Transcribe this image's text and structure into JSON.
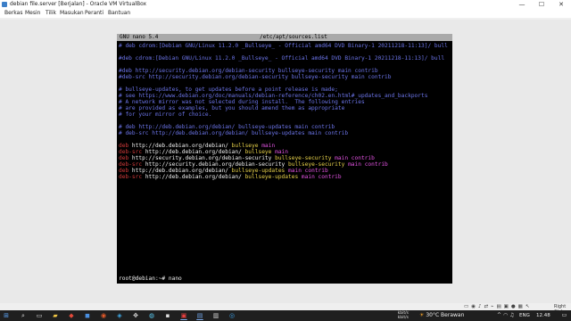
{
  "window": {
    "title": "debian file.server [Berjalan] - Oracle VM VirtualBox",
    "controls": [
      "—",
      "☐",
      "✕"
    ]
  },
  "menu": [
    "Berkas",
    "Mesin",
    "Tilik",
    "Masukan",
    "Peranti",
    "Bantuan"
  ],
  "terminal": {
    "header_left": "GNU nano 5.4",
    "header_file": "/etc/apt/sources.list",
    "lines": [
      {
        "row": 0,
        "parts": [
          {
            "t": "# deb cdrom:[Debian GNU/Linux 11.2.0 _Bullseye_ - Official amd64 DVD Binary-1 20211218-11:13]/ bull",
            "c": "blue"
          }
        ]
      },
      {
        "row": 2,
        "parts": [
          {
            "t": "#deb cdrom:[Debian GNU/Linux 11.2.0 _Bullseye_ - Official amd64 DVD Binary-1 20211218-11:13]/ bull",
            "c": "blue"
          }
        ]
      },
      {
        "row": 4,
        "parts": [
          {
            "t": "#deb http://security.debian.org/debian-security bullseye-security main contrib",
            "c": "blue"
          }
        ]
      },
      {
        "row": 5,
        "parts": [
          {
            "t": "#deb-src http://security.debian.org/debian-security bullseye-security main contrib",
            "c": "blue"
          }
        ]
      },
      {
        "row": 7,
        "parts": [
          {
            "t": "# bullseye-updates, to get updates before a point release is made;",
            "c": "blue"
          }
        ]
      },
      {
        "row": 8,
        "parts": [
          {
            "t": "# see https://www.debian.org/doc/manuals/debian-reference/ch02.en.html#_updates_and_backports",
            "c": "blue"
          }
        ]
      },
      {
        "row": 9,
        "parts": [
          {
            "t": "# A network mirror was not selected during install.  The following entries",
            "c": "blue"
          }
        ]
      },
      {
        "row": 10,
        "parts": [
          {
            "t": "# are provided as examples, but you should amend them as appropriate",
            "c": "blue"
          }
        ]
      },
      {
        "row": 11,
        "parts": [
          {
            "t": "# for your mirror of choice.",
            "c": "blue"
          }
        ]
      },
      {
        "row": 13,
        "parts": [
          {
            "t": "# deb http://deb.debian.org/debian/ bullseye-updates main contrib",
            "c": "blue"
          }
        ]
      },
      {
        "row": 14,
        "parts": [
          {
            "t": "# deb-src http://deb.debian.org/debian/ bullseye-updates main contrib",
            "c": "blue"
          }
        ]
      },
      {
        "row": 16,
        "parts": [
          {
            "t": "deb ",
            "c": "red"
          },
          {
            "t": "http://deb.debian.org/debian/ ",
            "c": "white"
          },
          {
            "t": "bullseye ",
            "c": "yellow"
          },
          {
            "t": "main",
            "c": "magenta"
          }
        ]
      },
      {
        "row": 17,
        "parts": [
          {
            "t": "deb-src ",
            "c": "red"
          },
          {
            "t": "http://deb.debian.org/debian/ ",
            "c": "white"
          },
          {
            "t": "bullseye ",
            "c": "yellow"
          },
          {
            "t": "main",
            "c": "magenta"
          }
        ]
      },
      {
        "row": 18,
        "parts": [
          {
            "t": "deb ",
            "c": "red"
          },
          {
            "t": "http://security.debian.org/debian-security ",
            "c": "white"
          },
          {
            "t": "bullseye-security ",
            "c": "yellow"
          },
          {
            "t": "main contrib",
            "c": "magenta"
          }
        ]
      },
      {
        "row": 19,
        "parts": [
          {
            "t": "deb-src ",
            "c": "red"
          },
          {
            "t": "http://security.debian.org/debian-security ",
            "c": "white"
          },
          {
            "t": "bullseye-security ",
            "c": "yellow"
          },
          {
            "t": "main contrib",
            "c": "magenta"
          }
        ]
      },
      {
        "row": 20,
        "parts": [
          {
            "t": "deb ",
            "c": "red"
          },
          {
            "t": "http://deb.debian.org/debian/ ",
            "c": "white"
          },
          {
            "t": "bullseye-updates ",
            "c": "yellow"
          },
          {
            "t": "main contrib",
            "c": "magenta"
          }
        ]
      },
      {
        "row": 21,
        "parts": [
          {
            "t": "deb-src ",
            "c": "red"
          },
          {
            "t": "http://deb.debian.org/debian/ ",
            "c": "white"
          },
          {
            "t": "bullseye-updates ",
            "c": "yellow"
          },
          {
            "t": "main contrib",
            "c": "magenta"
          }
        ]
      }
    ],
    "prompt": "root@debian:~# nano"
  },
  "colors": {
    "blue": "#6b74e8",
    "red": "#d33a3a",
    "white": "#f2f2f2",
    "yellow": "#e8d24a",
    "magenta": "#e353e3"
  },
  "statusbar": {
    "host_key": "Right Ctrl",
    "icons": [
      "hard-disk-icon",
      "optical-drive-icon",
      "audio-icon",
      "network-icon",
      "usb-icon",
      "shared-folder-icon",
      "display-icon",
      "recording-icon",
      "cpu-icon",
      "mouse-integration-icon"
    ]
  },
  "taskbar": {
    "net_up": "kbit/s",
    "net_down": "kbit/s",
    "weather": "30°C Berawan",
    "lang": "ENG",
    "time": "12.48"
  }
}
